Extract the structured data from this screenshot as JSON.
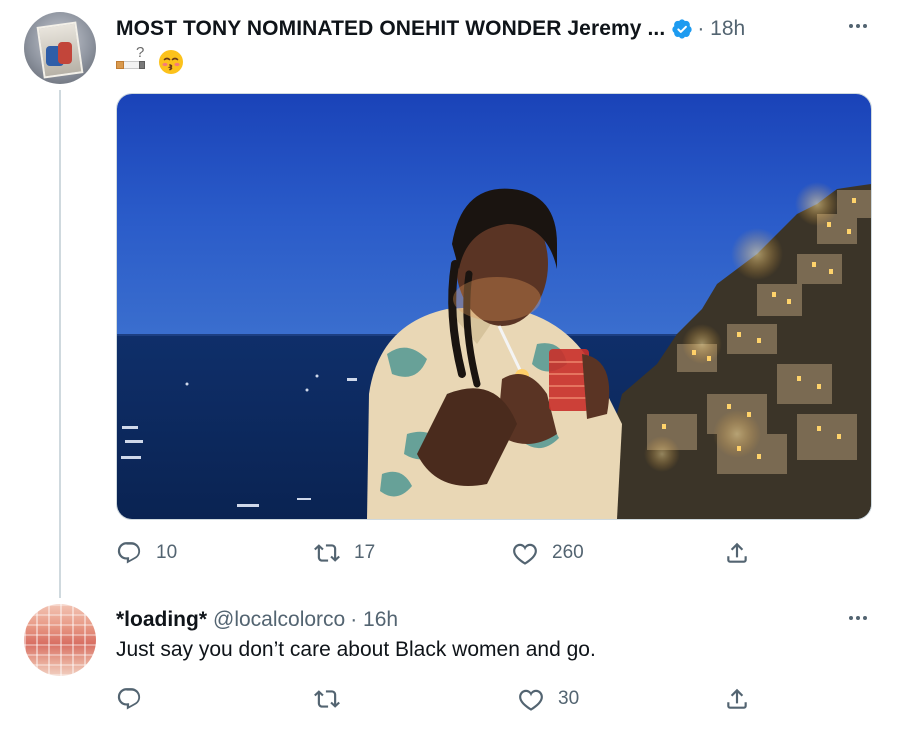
{
  "tweet": {
    "author_name": "MOST TONY NOMINATED ONEHIT WONDER Jeremy ...",
    "verified": true,
    "time": "· 18h",
    "text_emoji": "🚬❓😚",
    "image_icon": "photo",
    "actions": {
      "reply_count": "10",
      "retweet_count": "17",
      "like_count": "260"
    }
  },
  "reply": {
    "author_name": "*loading*",
    "handle": "@localcolorco",
    "time": "· 16h",
    "text": "Just say you don’t care about Black women and go.",
    "actions": {
      "reply_count": "",
      "retweet_count": "",
      "like_count": "30"
    }
  },
  "icons": {
    "reply": "reply-icon",
    "retweet": "retweet-icon",
    "like": "like-icon",
    "share": "share-icon",
    "more": "more-icon",
    "verified": "verified-badge-icon"
  },
  "colors": {
    "accent": "#1d9bf0",
    "secondary_text": "#536471",
    "thread_line": "#cfd9de"
  }
}
